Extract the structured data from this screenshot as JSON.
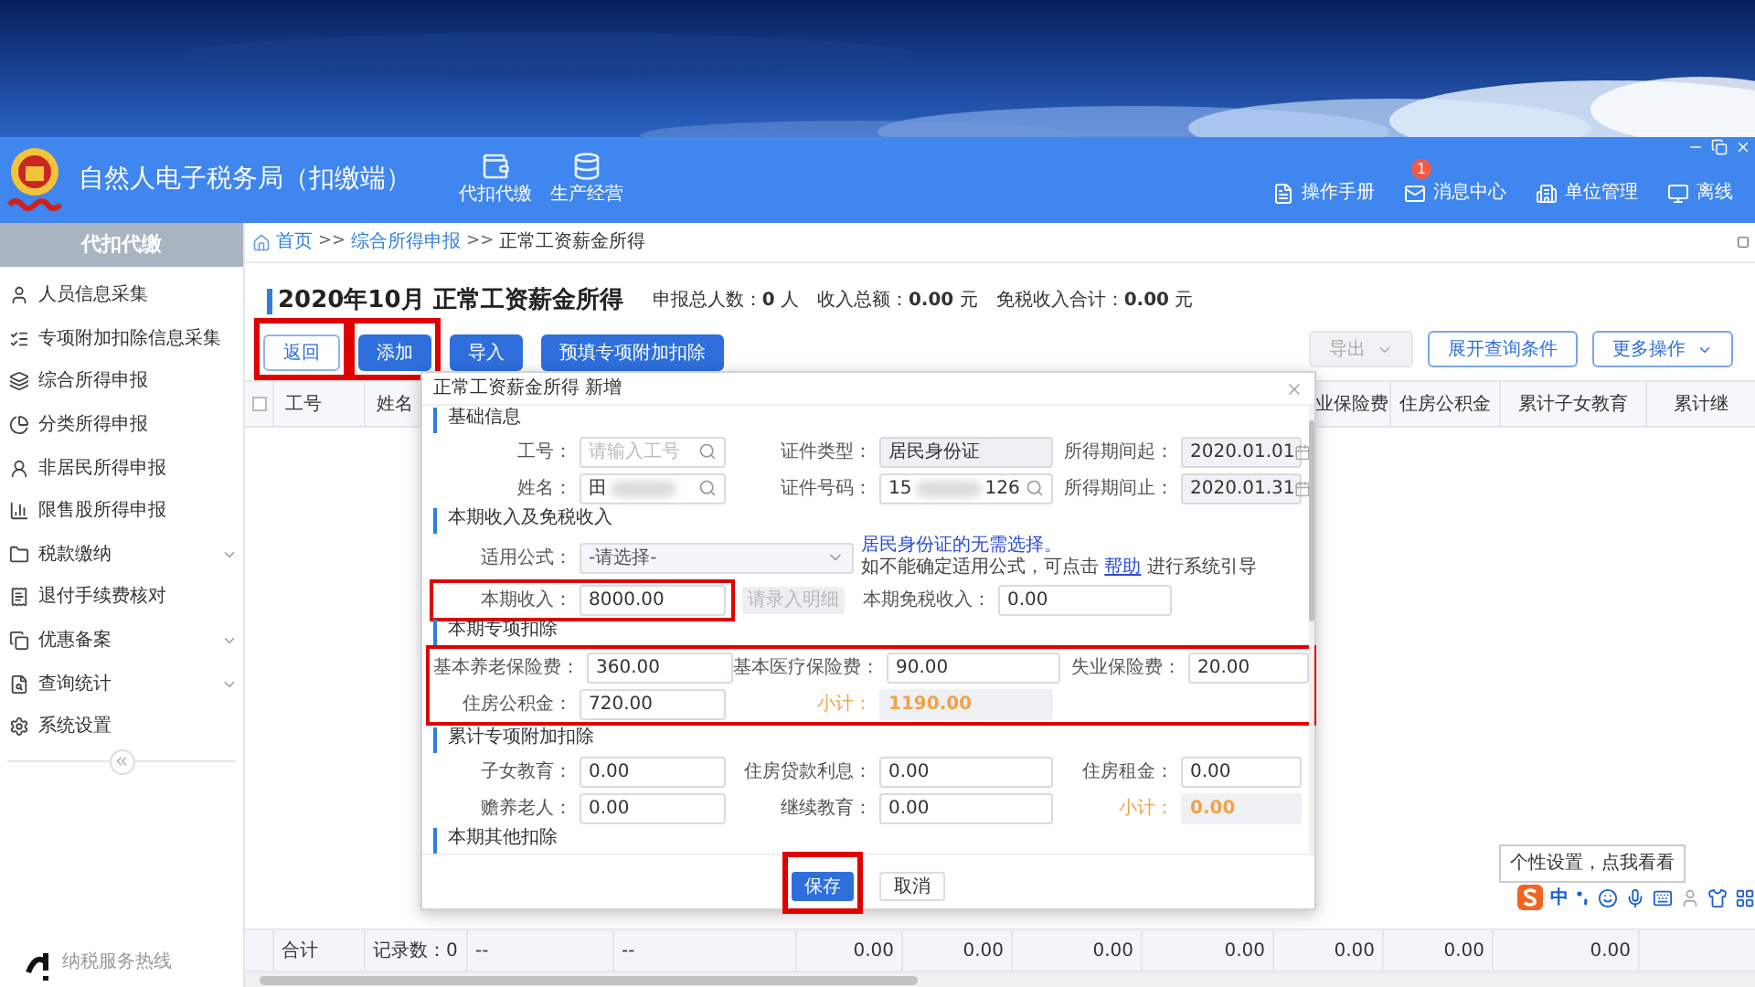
{
  "app": {
    "title": "自然人电子税务局（扣缴端）",
    "nav": [
      {
        "label": "代扣代缴"
      },
      {
        "label": "生产经营"
      }
    ],
    "actions": [
      {
        "label": "操作手册"
      },
      {
        "label": "消息中心",
        "badge": "1"
      },
      {
        "label": "单位管理"
      },
      {
        "label": "离线"
      }
    ]
  },
  "sidebar": {
    "title": "代扣代缴",
    "items": [
      {
        "label": "人员信息采集",
        "has_submenu": false
      },
      {
        "label": "专项附加扣除信息采集",
        "has_submenu": false
      },
      {
        "label": "综合所得申报",
        "has_submenu": false
      },
      {
        "label": "分类所得申报",
        "has_submenu": false
      },
      {
        "label": "非居民所得申报",
        "has_submenu": false
      },
      {
        "label": "限售股所得申报",
        "has_submenu": false
      },
      {
        "label": "税款缴纳",
        "has_submenu": true
      },
      {
        "label": "退付手续费核对",
        "has_submenu": false
      },
      {
        "label": "优惠备案",
        "has_submenu": true
      },
      {
        "label": "查询统计",
        "has_submenu": true
      },
      {
        "label": "系统设置",
        "has_submenu": false
      }
    ],
    "hotline": "纳税服务热线"
  },
  "breadcrumb": [
    {
      "label": "首页",
      "link": true
    },
    {
      "sep": ">>",
      "label": "综合所得申报",
      "link": true
    },
    {
      "sep": ">>",
      "label": "正常工资薪金所得",
      "link": false
    }
  ],
  "page": {
    "title": "2020年10月 正常工资薪金所得",
    "stats": [
      {
        "label": "申报总人数：",
        "value": "0",
        "unit": " 人"
      },
      {
        "label": "收入总额：",
        "value": "0.00",
        "unit": " 元"
      },
      {
        "label": "免税收入合计：",
        "value": "0.00",
        "unit": " 元"
      }
    ]
  },
  "toolbar_left": [
    {
      "label": "返回",
      "kind": "outline",
      "highlighted": true
    },
    {
      "label": "添加",
      "kind": "primary",
      "highlighted": true
    },
    {
      "label": "导入",
      "kind": "primary",
      "highlighted": false
    },
    {
      "label": "预填专项附加扣除",
      "kind": "primary",
      "highlighted": false
    }
  ],
  "toolbar_right": [
    {
      "label": "导出",
      "disabled": true,
      "caret": true
    },
    {
      "label": "展开查询条件",
      "disabled": false,
      "caret": false
    },
    {
      "label": "更多操作",
      "disabled": false,
      "caret": true
    }
  ],
  "table": {
    "select_all_checked": false,
    "columns_left": [
      "工号",
      "姓名"
    ],
    "columns_right": [
      "业保险费",
      "住房公积金",
      "累计子女教育",
      "累计继"
    ],
    "footer": [
      "合计",
      "记录数：0",
      "--",
      "--",
      "0.00",
      "0.00",
      "0.00",
      "0.00",
      "0.00",
      "0.00",
      "0.00"
    ]
  },
  "dialog": {
    "title": "正常工资薪金所得 新增",
    "sections": [
      {
        "title": "基础信息",
        "highlighted": false,
        "rows": [
          [
            {
              "kind": "search",
              "label": "工号：",
              "placeholder": "请输入工号"
            },
            {
              "kind": "readonly",
              "label": "证件类型：",
              "value": "居民身份证"
            },
            {
              "kind": "date",
              "label": "所得期间起：",
              "value": "2020.01.01"
            }
          ],
          [
            {
              "kind": "search",
              "label": "姓名：",
              "value": "田",
              "redacted": true
            },
            {
              "kind": "search",
              "label": "证件号码：",
              "value": "15",
              "value_tail": "126",
              "redacted": true
            },
            {
              "kind": "date",
              "label": "所得期间止：",
              "value": "2020.01.31"
            }
          ]
        ]
      },
      {
        "title": "本期收入及免税收入",
        "highlighted": false,
        "rows": [
          [
            {
              "kind": "select",
              "label": "适用公式：",
              "value": "-请选择-"
            },
            {
              "kind": "note",
              "highlight_text": "居民身份证的无需选择。",
              "text_before": "如不能确定适用公式，可点击 ",
              "link": "帮助",
              "text_after": " 进行系统引导"
            }
          ],
          [
            {
              "kind": "input",
              "label": "本期收入：",
              "value": "8000.00",
              "highlighted": true,
              "detail_button": "请录入明细"
            },
            {
              "kind": "input",
              "label": "本期免税收入：",
              "value": "0.00",
              "highlighted": false
            }
          ]
        ]
      },
      {
        "title": "本期专项扣除",
        "highlighted": true,
        "rows": [
          [
            {
              "kind": "input",
              "label": "基本养老保险费：",
              "value": "360.00"
            },
            {
              "kind": "input",
              "label": "基本医疗保险费：",
              "value": "90.00"
            },
            {
              "kind": "input",
              "label": "失业保险费：",
              "value": "20.00"
            }
          ],
          [
            {
              "kind": "input",
              "label": "住房公积金：",
              "value": "720.00"
            },
            {
              "kind": "subtotal",
              "label": "小计：",
              "value": "1190.00"
            }
          ]
        ]
      },
      {
        "title": "累计专项附加扣除",
        "highlighted": false,
        "rows": [
          [
            {
              "kind": "input",
              "label": "子女教育：",
              "value": "0.00"
            },
            {
              "kind": "input",
              "label": "住房贷款利息：",
              "value": "0.00"
            },
            {
              "kind": "input",
              "label": "住房租金：",
              "value": "0.00"
            }
          ],
          [
            {
              "kind": "input",
              "label": "赡养老人：",
              "value": "0.00"
            },
            {
              "kind": "input",
              "label": "继续教育：",
              "value": "0.00"
            },
            {
              "kind": "subtotal",
              "label": "小计：",
              "value": "0.00"
            }
          ]
        ]
      },
      {
        "title": "本期其他扣除",
        "highlighted": false
      }
    ],
    "buttons": [
      {
        "label": "保存",
        "kind": "primary",
        "highlighted": true
      },
      {
        "label": "取消",
        "kind": "default",
        "highlighted": false
      }
    ]
  },
  "ime": {
    "tooltip": "个性设置，点我看看",
    "mode": "中"
  }
}
